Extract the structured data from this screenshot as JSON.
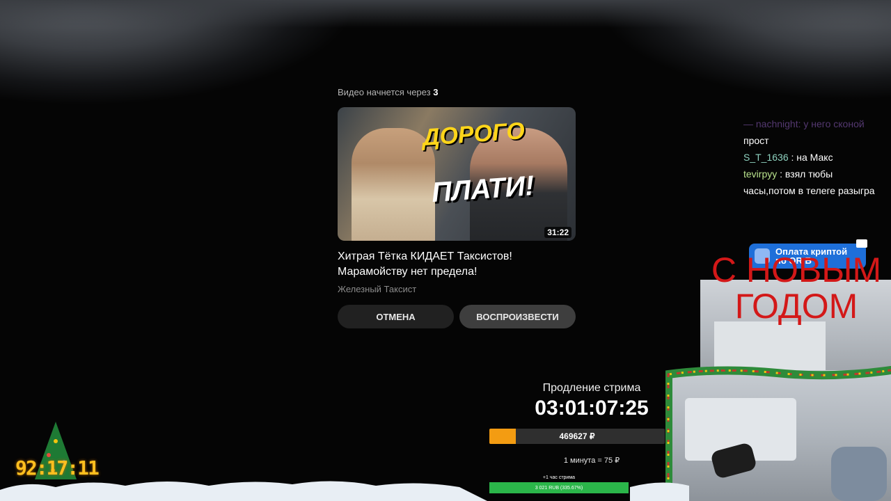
{
  "video_card": {
    "countdown_text": "Видео начнется через",
    "countdown_value": "3",
    "thumbnail_text_1": "ДОРОГО",
    "thumbnail_text_2": "ПЛАТИ!",
    "duration": "31:22",
    "title": "Хитрая Тётка КИДАЕТ Таксистов! Марамойству нет предела!",
    "channel": "Железный Таксист",
    "cancel_label": "ОТМЕНА",
    "play_label": "ВОСПРОИЗВЕСТИ"
  },
  "chat": {
    "partial_line": "— nachnight: у него сконой",
    "lines": [
      {
        "user": "",
        "text": "прост"
      },
      {
        "user": "S_T_1636",
        "text": ": на Макс"
      },
      {
        "user": "tevirpyy",
        "text": ": взял тюбы"
      },
      {
        "user": "",
        "text": "часы,потом в телеге разыгра"
      }
    ]
  },
  "crypto_banner": {
    "line1": "Оплата криптой",
    "line2": "по QR Б"
  },
  "overlay_text": {
    "line1": "С НОВЫМ",
    "line2": "ГОДОМ"
  },
  "extension": {
    "title": "Продление стрима",
    "timer": "03:01:07:25",
    "amount": "469627 ₽",
    "amount_progress": 0.15,
    "rate": "1 минута = 75 ₽"
  },
  "goal": {
    "label": "+1 час стрима",
    "amount": "3 021 RUB (335.67%)",
    "progress": 1.0
  },
  "clock": {
    "time": "92:17:11"
  },
  "colors": {
    "progress_orange": "#f39c12",
    "goal_green": "#2bb64a",
    "newyear_red": "#d31818",
    "crypto_blue": "#1e6fd9",
    "clock_yellow": "#ffbf1f"
  }
}
